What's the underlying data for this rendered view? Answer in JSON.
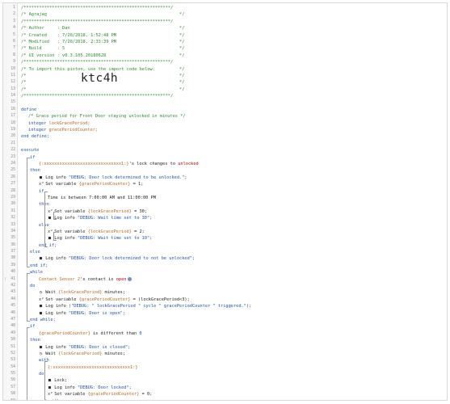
{
  "header": {
    "border": "/*********************************************************/",
    "piston_name": "Agrajag",
    "author_label": "Author",
    "author": "Dan",
    "created_label": "Created",
    "created": "7/20/2018, 1:52:48 PM",
    "modified_label": "Modified",
    "modified": "7/20/2018, 2:33:39 PM",
    "build_label": "Build",
    "build": "5",
    "ui_label": "UI version",
    "ui_version": "v0.3.105.20180628",
    "import_text": "To import this piston, use the import code below:",
    "import_code": "ktc4h"
  },
  "gutter": {
    "line_numbers": [
      "1",
      "2",
      "3",
      "4",
      "5",
      "6",
      "7",
      "8",
      "9",
      "10",
      "11",
      "12",
      "13",
      "14",
      "15",
      "16",
      "17",
      "18",
      "19",
      "20",
      "21",
      "22",
      "23",
      "24",
      "25",
      "26",
      "27",
      "28",
      "29",
      "30",
      "31",
      "32",
      "33",
      "34",
      "35",
      "36",
      "37",
      "38",
      "39",
      "40",
      "41",
      "42",
      "43",
      "44",
      "45",
      "46",
      "47",
      "48",
      "49",
      "50",
      "51",
      "52",
      "53",
      "54",
      "55",
      "56",
      "57",
      "58",
      "59",
      "60",
      "61",
      "62",
      "63"
    ],
    "warning_mark": "!"
  },
  "code": {
    "define": "define",
    "define_comment": "/* Grace period for Front Door staying unlocked in minutes */",
    "type_integer": "integer",
    "var_lock_grace": "lockGracePeriod;",
    "var_grace_counter": "gracePeriodCounter;",
    "end_define": "end define;",
    "execute": "execute",
    "if": "if",
    "device_masked": "{:xxxxxxxxxxxxxxxxxxxxxxxxxxxxxx1:}",
    "lock_changes": "'s lock changes to",
    "unlocked": "unlocked",
    "then": "then",
    "log_info": "Log info",
    "msg_unlocked": "\"DEBUG: Door lock determined to be unlocked.\";",
    "set_variable": "Set variable",
    "grace_counter_brace": "{gracePeriodCounter}",
    "eq_1": "= 1;",
    "time_between": "Time is between 7:00:00 AM and 11:00:00 PM",
    "lock_grace_brace": "{lockGracePeriod}",
    "eq_30": "= 30;",
    "msg_wait30": "\"DEBUG: Wait time set to 30\";",
    "else": "else",
    "eq_2": "= 2;",
    "msg_wait10": "\"DEBUG: Wait time set to 10\";",
    "end_if": "end if;",
    "msg_not_unlocked": "\"DEBUG: Door lock determined to not be unlocked\";",
    "while": "while",
    "contact_sensor": "Contact Sensor 2",
    "contact_is": "'s contact is",
    "open": "open",
    "do": "do",
    "wait": "Wait",
    "minutes": "minutes;",
    "eq_counter_plus": "= (lockGracePeriod<3);",
    "msg_cycle": "(\"DEBUG: \" lockGracePeriod \" cycle \" gracePeriodCounter \" triggered.\");",
    "msg_open": "\"DEBUG: Door is open\";",
    "end_while": "end while;",
    "diff_than": "is different than",
    "zero": "0",
    "msg_closed": "\"DEBUG: Door is closed\";",
    "with": "with",
    "lock": "Lock;",
    "msg_locked": "\"DEBUG: Door locked\";",
    "eq_0": "= 0;",
    "end_with": "end with;",
    "end_execute": "end execute;"
  },
  "colors": {
    "comment": "#2b8a2b",
    "keyword": "#1f4fa8",
    "variable": "#b5671e",
    "device": "#b00000"
  }
}
